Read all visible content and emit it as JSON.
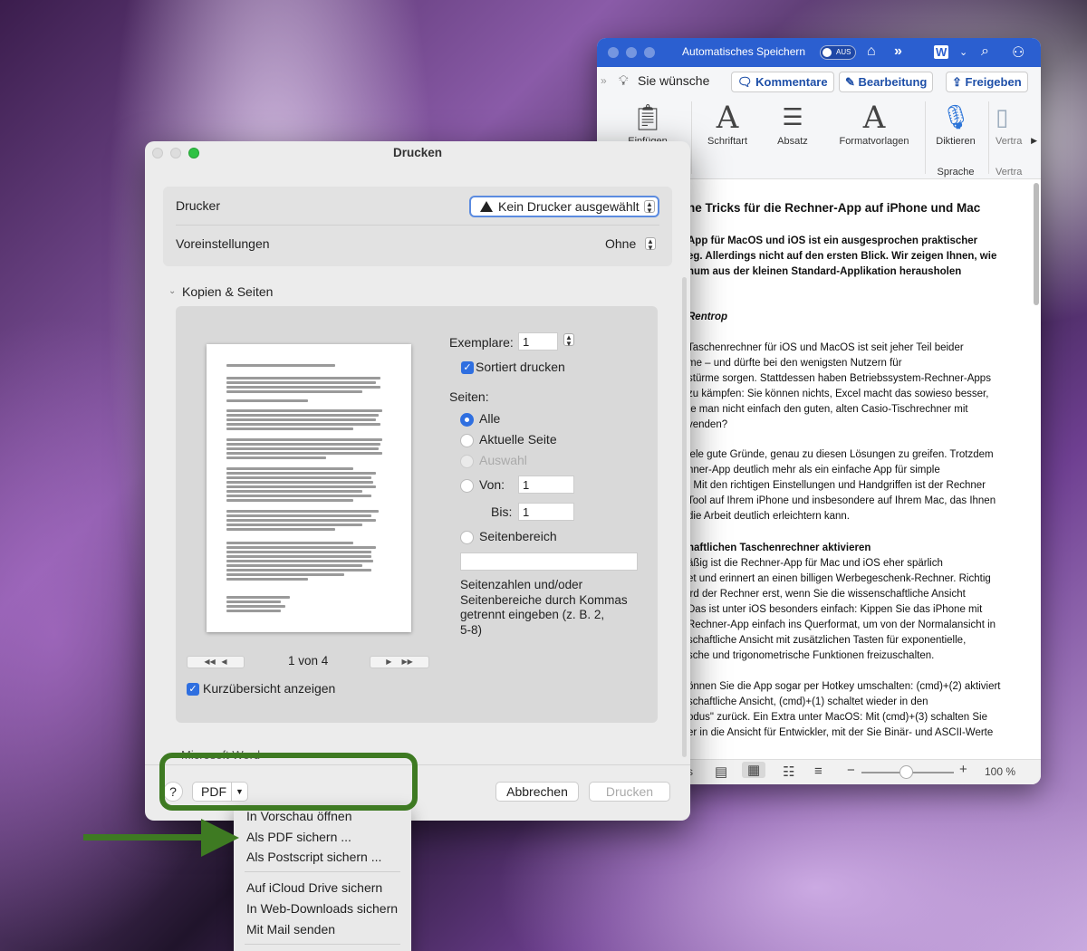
{
  "word": {
    "autosave_label": "Automatisches Speichern",
    "autosave_state": "AUS",
    "wish_label": "Sie wünsche",
    "buttons": {
      "comments": "Kommentare",
      "editing": "Bearbeitung",
      "share": "Freigeben"
    },
    "ribbon": {
      "paste_label": "Einfügen",
      "font_label": "Schriftart",
      "paragraph_label": "Absatz",
      "styles_label": "Formatvorlagen",
      "dictate_label": "Diktieren",
      "speech_group": "Sprache",
      "confidential_label": "Vertra",
      "confidential_group": "Vertra"
    },
    "doc_lines": [
      "he Tricks für die Rechner-App auf iPhone und Mac",
      "App für MacOS und iOS ist ein ausgesprochen praktischer",
      "eg. Allerdings nicht auf den ersten Blick. Wir zeigen Ihnen, wie",
      "num aus der kleinen Standard-Applikation herausholen",
      "Rentrop",
      "Taschenrechner für iOS und MacOS ist seit jeher Teil beider",
      "me – und dürfte bei den wenigsten Nutzern für",
      "stürme sorgen. Stattdessen haben Betriebssystem-Rechner-Apps",
      " zu kämpfen: Sie können nichts, Excel macht das sowieso besser,",
      "te man nicht einfach den guten, alten Casio-Tischrechner mit",
      "venden?",
      "iele gute Gründe, genau zu diesen Lösungen zu greifen. Trotzdem",
      "hner-App deutlich mehr als ein einfache App für simple",
      ": Mit den richtigen Einstellungen und Handgriffen ist der Rechner",
      " Tool auf Ihrem iPhone und insbesondere auf Ihrem Mac, das Ihnen",
      " die Arbeit deutlich erleichtern kann.",
      "haftlichen Taschenrechner aktivieren",
      "äßig ist die Rechner-App für Mac und iOS eher spärlich",
      "et und erinnert an einen billigen Werbegeschenk-Rechner. Richtig",
      "ird der Rechner erst, wenn Sie die wissenschaftliche Ansicht",
      "Das ist unter iOS besonders einfach: Kippen Sie das iPhone mit",
      "Rechner-App einfach ins Querformat, um von der Normalansicht in",
      "schaftliche Ansicht mit zusätzlichen Tasten für exponentielle,",
      "sche und trigonometrische Funktionen freizuschalten.",
      "önnen Sie die App sogar per Hotkey umschalten: (cmd)+(2) aktiviert",
      "schaftliche Ansicht, (cmd)+(1) schaltet wieder in den",
      "odus\" zurück. Ein Extra unter MacOS: Mit (cmd)+(3) schalten Sie",
      "er in die Ansicht für Entwickler, mit der Sie Binär- und ASCII-Werte"
    ],
    "zoom": "100 %",
    "status_left": "s"
  },
  "print": {
    "title": "Drucken",
    "printer_label": "Drucker",
    "printer_value": "Kein Drucker ausgewählt",
    "presets_label": "Voreinstellungen",
    "presets_value": "Ohne",
    "section_label": "Kopien & Seiten",
    "copies_label": "Exemplare:",
    "copies_value": "1",
    "collate_label": "Sortiert drucken",
    "pages_label": "Seiten:",
    "opt_all": "Alle",
    "opt_current": "Aktuelle Seite",
    "opt_selection": "Auswahl",
    "from_label": "Von:",
    "from_value": "1",
    "to_label": "Bis:",
    "to_value": "1",
    "opt_range": "Seitenbereich",
    "range_hint": [
      "Seitenzahlen und/oder",
      "Seitenbereiche durch Kommas",
      "getrennt eingeben (z. B. 2,",
      "5-8)"
    ],
    "page_counter": "1 von 4",
    "nav": {
      "first": "◀◀",
      "prev": "◀",
      "next": "▶",
      "last": "▶▶"
    },
    "show_preview_label": "Kurzübersicht anzeigen",
    "app_section_cut": "Microsoft Word",
    "help": "?",
    "pdf_label": "PDF",
    "cancel": "Abbrechen",
    "print": "Drucken"
  },
  "pdf_menu": {
    "items": [
      "In Vorschau öffnen",
      "Als PDF sichern ...",
      "Als Postscript sichern ...",
      "Auf iCloud Drive sichern",
      "In Web-Downloads sichern",
      "Mit Mail senden"
    ]
  },
  "colors": {
    "word_blue": "#2b5fd0",
    "accent_blue": "#2f6fe0",
    "annotation_green": "#3e7a22"
  }
}
